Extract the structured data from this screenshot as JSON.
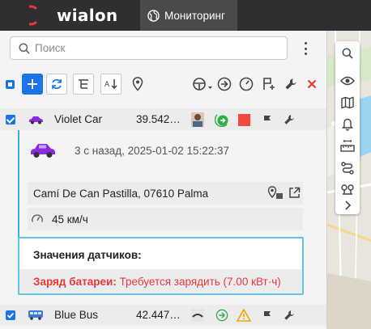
{
  "header": {
    "logo_text": "wialon",
    "tab_label": "Мониторинг"
  },
  "search": {
    "placeholder": "Поиск",
    "value": ""
  },
  "units": [
    {
      "name": "Violet Car",
      "value": "39.542…",
      "details": {
        "time": "3 с назад, 2025-01-02 15:22:37",
        "address": "Camí De Can Pastilla, 07610 Palma",
        "speed": "45 км/ч"
      },
      "sensors": {
        "title": "Значения датчиков:",
        "items": [
          {
            "name": "Заряд батареи:",
            "value": "Требуется зарядить (7.00 кВт·ч)"
          }
        ]
      }
    },
    {
      "name": "Blue Bus",
      "value": "42.447…"
    }
  ],
  "colors": {
    "accent": "#1a73e8",
    "header_bg": "#2f2f2f",
    "brand_red": "#e8383d",
    "sensor_border": "#5fc6ea",
    "status_green": "#2eae47",
    "status_red": "#f04a3c",
    "warning": "#f0a500"
  }
}
